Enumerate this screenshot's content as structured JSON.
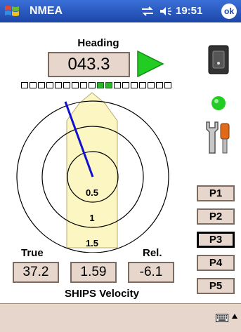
{
  "statusbar": {
    "app_title": "NMEA",
    "time": "19:51",
    "ok_label": "ok"
  },
  "heading": {
    "label": "Heading",
    "value": "043.3",
    "indicators": [
      0,
      0,
      0,
      0,
      0,
      0,
      0,
      0,
      0,
      1,
      1,
      0,
      0,
      0,
      0,
      0,
      0,
      0
    ]
  },
  "dial": {
    "ring_labels": [
      "0.5",
      "1",
      "1.5"
    ],
    "needle_heading_deg": -20
  },
  "velocity": {
    "true_label": "True",
    "rel_label": "Rel.",
    "true_value": "37.2",
    "speed_value": "1.59",
    "rel_value": "-6.1",
    "title": "SHIPS Velocity"
  },
  "pages": {
    "buttons": [
      "P1",
      "P2",
      "P3",
      "P4",
      "P5"
    ],
    "selected": "P3"
  },
  "icons": {
    "windows_logo": "windows-logo-icon",
    "connectivity": "connectivity-icon",
    "volume": "volume-icon",
    "switch": "power-switch-icon",
    "led": "status-led-icon",
    "tools": "tools-icon",
    "keyboard": "keyboard-icon"
  },
  "colors": {
    "titlebar": "#1c46a8",
    "value_box": "#e6d6cc",
    "indicator_on": "#2cb52c",
    "led": "#22cc22",
    "needle": "#1010d0",
    "boat": "#fbf6c2"
  }
}
